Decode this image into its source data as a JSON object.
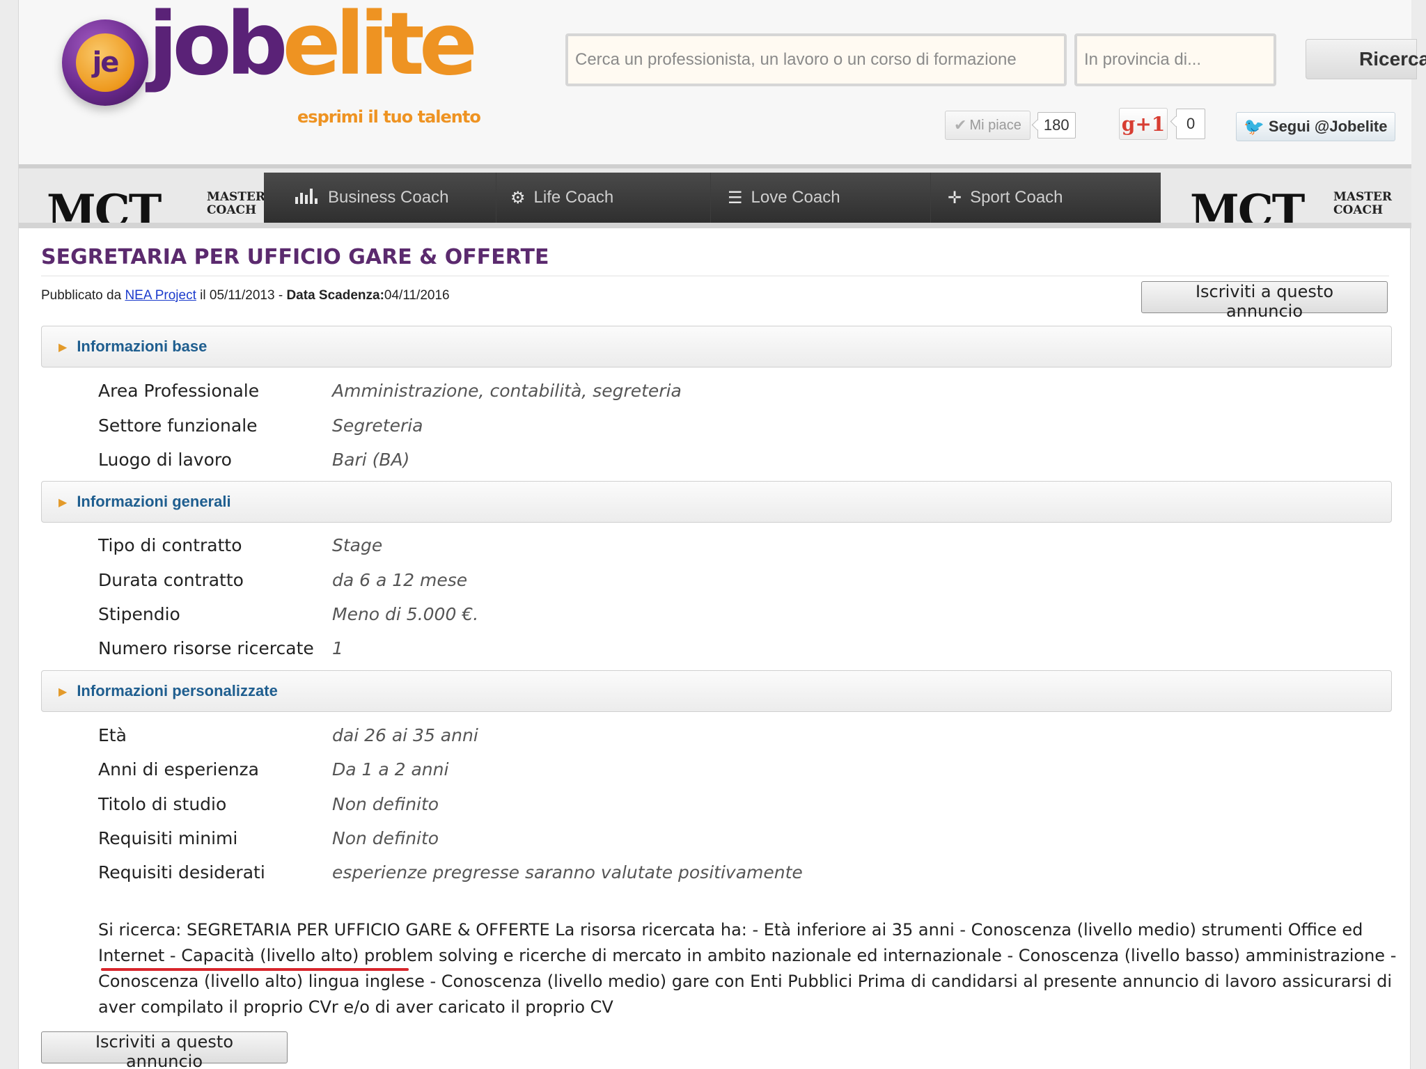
{
  "header": {
    "logo_badge": "je",
    "logo_word_a": "job",
    "logo_word_b": "elite",
    "tagline": "esprimi il tuo talento",
    "search_placeholder": "Cerca un professionista, un lavoro o un corso di formazione",
    "province_placeholder": "In provincia di...",
    "search_button": "Ricerca",
    "social": {
      "like_label": "Mi piace",
      "like_count": "180",
      "gplus_label": "g+1",
      "gplus_count": "0",
      "twitter_label": "Segui @Jobelite"
    }
  },
  "nav": {
    "banner_left": {
      "letters": "MCT",
      "sub1": "MASTER",
      "sub2": "COACH"
    },
    "banner_right": {
      "letters": "MCT",
      "sub1": "MASTER",
      "sub2": "COACH"
    },
    "items": [
      {
        "label": "Business Coach",
        "icon": "bar-chart-icon"
      },
      {
        "label": "Life Coach",
        "icon": "gears-icon"
      },
      {
        "label": "Love Coach",
        "icon": "stack-icon"
      },
      {
        "label": "Sport Coach",
        "icon": "target-icon"
      }
    ]
  },
  "job": {
    "title": "SEGRETARIA PER UFFICIO GARE & OFFERTE",
    "published_prefix": "Pubblicato da",
    "publisher": "NEA Project",
    "published_date_text": "il 05/11/2013 -",
    "deadline_label": "Data Scadenza:",
    "deadline": "04/11/2016",
    "apply_button": "Iscriviti a questo annuncio"
  },
  "sections": [
    {
      "label": "Informazioni base",
      "rows": [
        {
          "key": "Area Professionale",
          "value": "Amministrazione, contabilità, segreteria"
        },
        {
          "key": "Settore funzionale",
          "value": "Segreteria"
        },
        {
          "key": "Luogo di lavoro",
          "value": "Bari (BA)"
        }
      ]
    },
    {
      "label": "Informazioni generali",
      "rows": [
        {
          "key": "Tipo di contratto",
          "value": "Stage"
        },
        {
          "key": "Durata contratto",
          "value": "da 6 a 12 mese"
        },
        {
          "key": "Stipendio",
          "value": "Meno di 5.000 €."
        },
        {
          "key": "Numero risorse ricercate",
          "value": "1"
        }
      ]
    },
    {
      "label": "Informazioni personalizzate",
      "rows": [
        {
          "key": "Età",
          "value": "dai 26 ai 35 anni"
        },
        {
          "key": "Anni di esperienza",
          "value": "Da 1 a 2 anni"
        },
        {
          "key": "Titolo di studio",
          "value": "Non definito"
        },
        {
          "key": "Requisiti minimi",
          "value": "Non definito"
        },
        {
          "key": "Requisiti desiderati",
          "value": "esperienze pregresse saranno valutate positivamente"
        }
      ]
    }
  ],
  "description": "Si ricerca: SEGRETARIA PER UFFICIO GARE & OFFERTE La risorsa ricercata ha: - Età inferiore ai 35 anni - Conoscenza (livello medio) strumenti Office ed Internet - Capacità (livello alto) problem solving e ricerche di mercato in ambito nazionale ed internazionale - Conoscenza (livello basso) amministrazione - Conoscenza (livello alto) lingua inglese - Conoscenza (livello medio) gare con Enti Pubblici Prima di candidarsi al presente annuncio di lavoro assicurarsi di aver compilato il proprio CVr e/o di aver caricato il proprio CV",
  "colors": {
    "brand_purple": "#5a2277",
    "brand_orange": "#ee9322",
    "section_label": "#1f5e8f",
    "title": "#5b2a6e",
    "highlight_underline": "#d8262c"
  }
}
